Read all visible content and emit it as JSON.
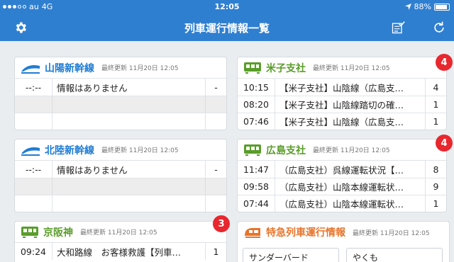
{
  "status_bar": {
    "carrier": "au",
    "network": "4G",
    "time": "12:05",
    "battery": "88%"
  },
  "navbar": {
    "title": "列車運行情報一覧",
    "settings_icon": "gear-icon",
    "checklist_icon": "checklist-icon",
    "refresh_icon": "refresh-icon"
  },
  "cards": {
    "sanyo": {
      "name": "山陽新幹線",
      "updated": "最終更新 11月20日 12:05",
      "rows": [
        {
          "time": "--:--",
          "text": "情報はありません",
          "count": "-"
        }
      ]
    },
    "hokuriku": {
      "name": "北陸新幹線",
      "updated": "最終更新 11月20日 12:05",
      "rows": [
        {
          "time": "--:--",
          "text": "情報はありません",
          "count": "-"
        }
      ]
    },
    "keihanshin": {
      "name": "京阪神",
      "updated": "最終更新 11月20日 12:05",
      "badge": "3",
      "rows": [
        {
          "time": "09:24",
          "text": "大和路線　お客様救護【列車…",
          "count": "1"
        }
      ]
    },
    "yonago": {
      "name": "米子支社",
      "updated": "最終更新 11月20日 12:05",
      "badge": "4",
      "rows": [
        {
          "time": "10:15",
          "text": "【米子支社】山陰線（広島支…",
          "count": "4"
        },
        {
          "time": "08:20",
          "text": "【米子支社】山陰線踏切の確…",
          "count": "1"
        },
        {
          "time": "07:46",
          "text": "【米子支社】山陰線（広島支…",
          "count": "1"
        }
      ]
    },
    "hiroshima": {
      "name": "広島支社",
      "updated": "最終更新 11月20日 12:05",
      "badge": "4",
      "rows": [
        {
          "time": "11:47",
          "text": "（広島支社）呉線運転状況【…",
          "count": "8"
        },
        {
          "time": "09:58",
          "text": "（広島支社）山陰本線運転状…",
          "count": "9"
        },
        {
          "time": "07:44",
          "text": "（広島支社）山陰本線運転状…",
          "count": "1"
        }
      ]
    },
    "express": {
      "name": "特急列車運行情報",
      "updated": "最終更新 11月20日 12:05",
      "items": [
        "サンダーバード",
        "やくも"
      ]
    }
  },
  "colors": {
    "navbar": "#2f7fd1",
    "badge": "#e8272e",
    "shinkansen": "#1f7cd3",
    "branch": "#5a9d2a",
    "express": "#e8742a"
  }
}
